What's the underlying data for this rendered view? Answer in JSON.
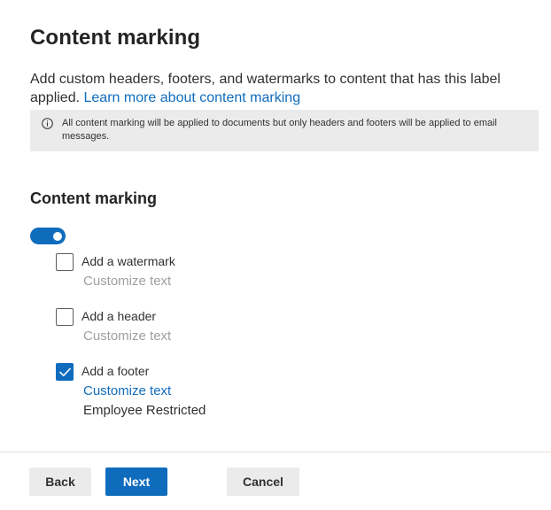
{
  "header": {
    "title": "Content marking",
    "description": "Add custom headers, footers, and watermarks to content that has this label applied. ",
    "learn_more_link": "Learn more about content marking"
  },
  "info_bar": {
    "icon": "info-icon",
    "text": "All content marking will be applied to documents but only headers and footers will be applied to email messages."
  },
  "section": {
    "title": "Content marking",
    "toggle_on": true
  },
  "options": {
    "watermark": {
      "label": "Add a watermark",
      "checked": false,
      "customize_label": "Customize text"
    },
    "header": {
      "label": "Add a header",
      "checked": false,
      "customize_label": "Customize text"
    },
    "footer": {
      "label": "Add a footer",
      "checked": true,
      "customize_label": "Customize text",
      "value": "Employee Restricted"
    }
  },
  "buttons": {
    "back": "Back",
    "next": "Next",
    "cancel": "Cancel"
  },
  "colors": {
    "accent": "#0f6cbd",
    "disabled_text": "#a19f9d",
    "info_bar_bg": "#ebebeb"
  }
}
